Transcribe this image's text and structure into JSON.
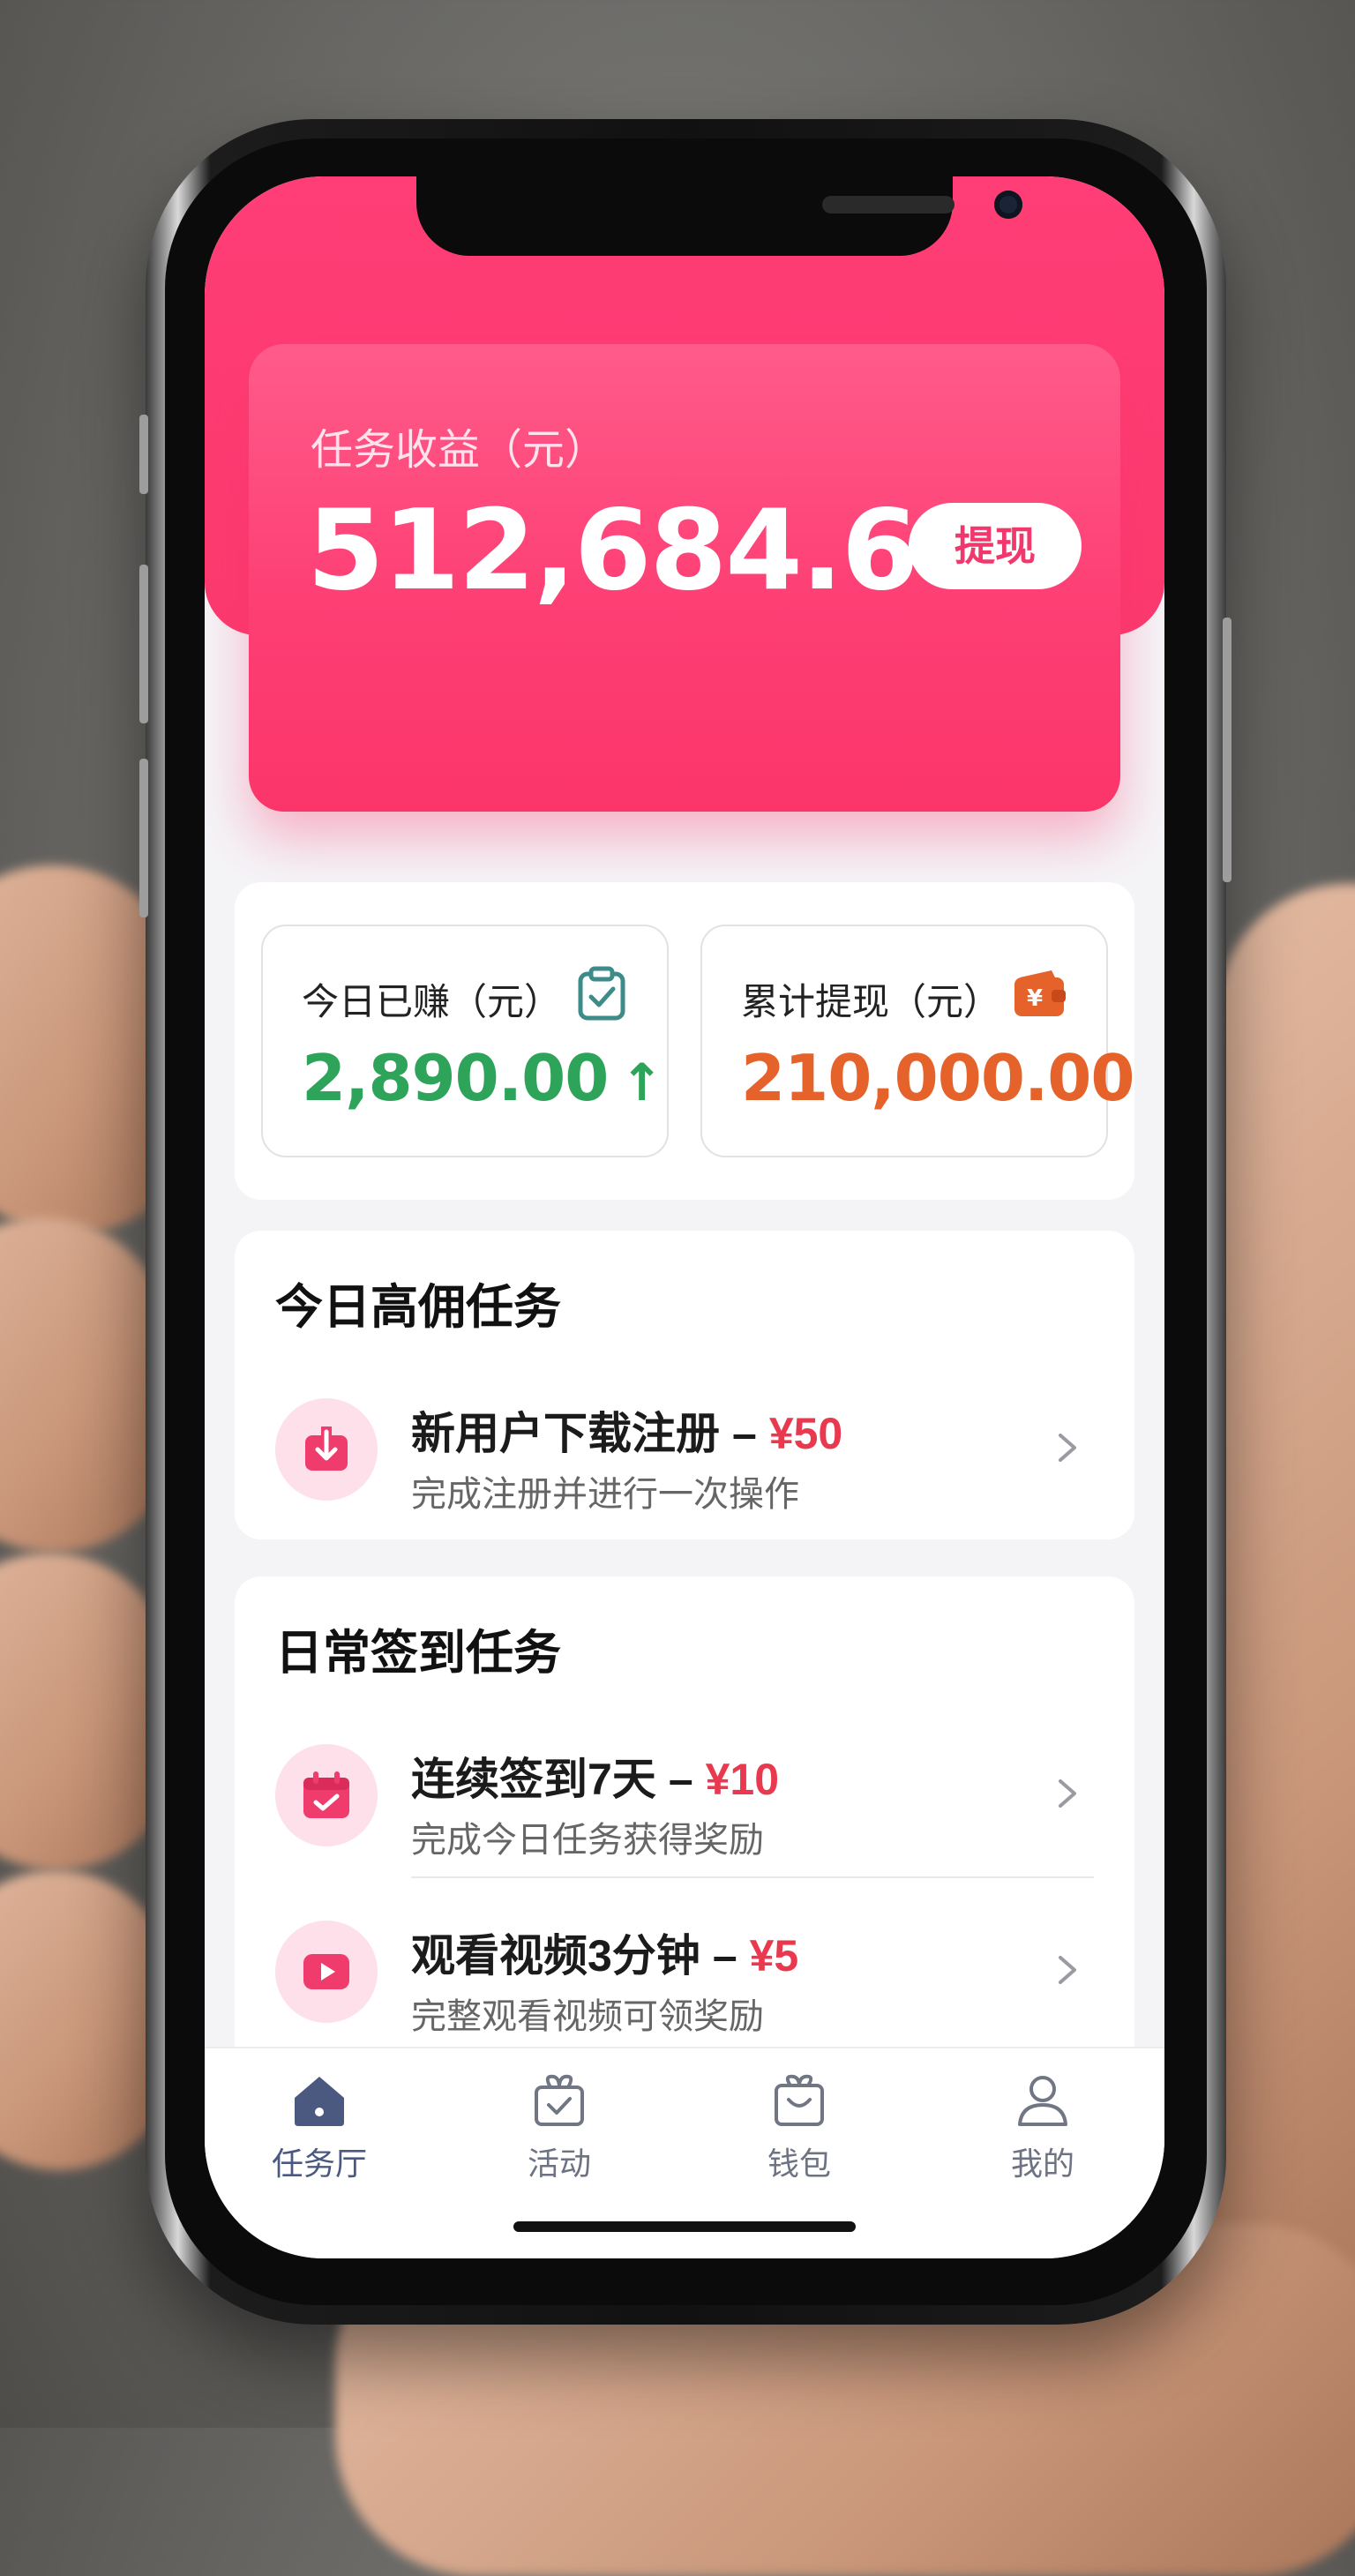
{
  "earnings": {
    "label": "任务收益（元）",
    "amount": "512,684.64",
    "withdraw_label": "提现"
  },
  "stats": {
    "today": {
      "label": "今日已赚（元）",
      "value": "2,890.00",
      "trend": "↑",
      "icon": "clipboard-check-icon",
      "color": "#2ea35a"
    },
    "total_withdraw": {
      "label": "累计提现（元）",
      "value": "210,000.00",
      "icon": "wallet-yuan-icon",
      "color": "#e5622a"
    }
  },
  "high_commission": {
    "title": "今日高佣任务",
    "tasks": [
      {
        "title": "新用户下载注册",
        "dash": "–",
        "reward": "¥50",
        "subtitle": "完成注册并进行一次操作",
        "icon": "download-icon"
      }
    ]
  },
  "daily_checkin": {
    "title": "日常签到任务",
    "tasks": [
      {
        "title": "连续签到7天",
        "dash": "–",
        "reward": "¥10",
        "subtitle": "完成今日任务获得奖励",
        "icon": "calendar-check-icon"
      },
      {
        "title": "观看视频3分钟",
        "dash": "–",
        "reward": "¥5",
        "subtitle": "完整观看视频可领奖励",
        "icon": "play-video-icon"
      }
    ]
  },
  "tabbar": {
    "items": [
      {
        "label": "任务厅",
        "icon": "home-icon",
        "active": true
      },
      {
        "label": "活动",
        "icon": "gift-check-icon",
        "active": false
      },
      {
        "label": "钱包",
        "icon": "bag-icon",
        "active": false
      },
      {
        "label": "我的",
        "icon": "user-icon",
        "active": false
      }
    ]
  },
  "colors": {
    "brand_pink": "#fb3a6e",
    "reward_red": "#e8394f",
    "green": "#2ea35a",
    "orange": "#e5622a"
  }
}
